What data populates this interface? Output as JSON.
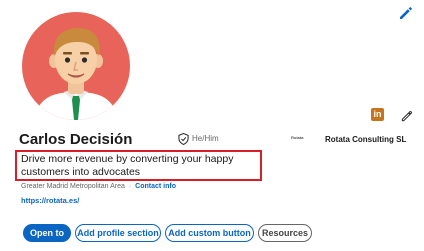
{
  "profile": {
    "name": "Carlos Decisión",
    "pronouns": "He/Him",
    "company": "Rotata Consulting SL",
    "company_logo_text": "Rotata",
    "headline": "Drive more revenue by converting your happy customers into advocates",
    "location": "Greater Madrid Metropolitan Area",
    "location_separator": "·",
    "contact_link": "Contact info",
    "website": "https://rotata.es/"
  },
  "badges": {
    "linkedin_label": "in"
  },
  "actions": {
    "open_to": "Open to",
    "add_profile_section": "Add profile section",
    "add_custom_button": "Add custom button",
    "resources": "Resources"
  },
  "colors": {
    "accent": "#0a66c2",
    "highlight_border": "#d71f28",
    "avatar_bg": "#e8645a",
    "linkedin_badge": "#c6751e"
  },
  "icons": {
    "edit_cover": "pencil-icon",
    "edit_intro": "pencil-icon",
    "verification": "shield-check-icon",
    "linkedin": "linkedin-icon"
  }
}
